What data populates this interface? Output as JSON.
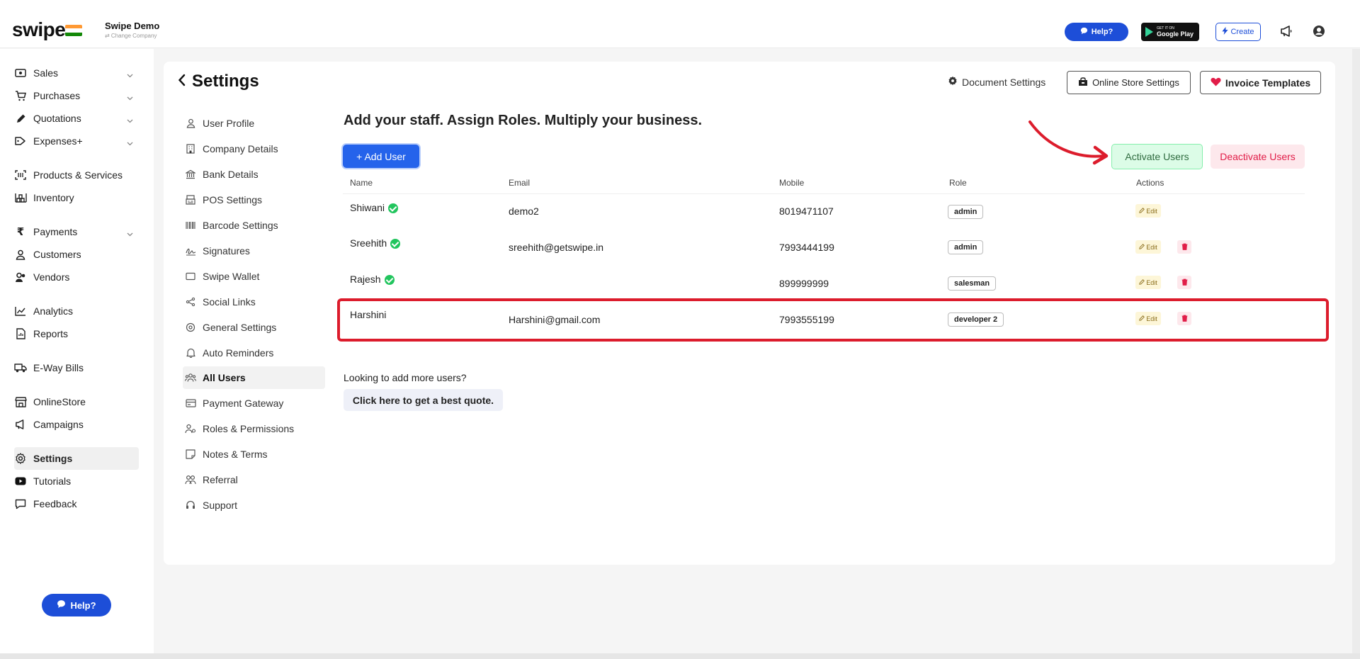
{
  "brand": {
    "logo": "swipe",
    "company_name": "Swipe Demo",
    "company_sub": "⇄ Change Company"
  },
  "topbar": {
    "help_label": "Help?",
    "gplay_top": "GET IT ON",
    "gplay_bottom": "Google Play",
    "create_label": "Create"
  },
  "sidebar": {
    "items": [
      {
        "label": "Sales"
      },
      {
        "label": "Purchases"
      },
      {
        "label": "Quotations"
      },
      {
        "label": "Expenses+"
      },
      {
        "label": "Products & Services"
      },
      {
        "label": "Inventory"
      },
      {
        "label": "Payments"
      },
      {
        "label": "Customers"
      },
      {
        "label": "Vendors"
      },
      {
        "label": "Analytics"
      },
      {
        "label": "Reports"
      },
      {
        "label": "E-Way Bills"
      },
      {
        "label": "OnlineStore"
      },
      {
        "label": "Campaigns"
      },
      {
        "label": "Settings"
      },
      {
        "label": "Tutorials"
      },
      {
        "label": "Feedback"
      }
    ],
    "help_label": "Help?"
  },
  "settings": {
    "title": "Settings",
    "document_settings": "Document Settings",
    "online_store_settings": "Online Store Settings",
    "invoice_templates": "Invoice Templates",
    "nav": [
      {
        "label": "User Profile"
      },
      {
        "label": "Company Details"
      },
      {
        "label": "Bank Details"
      },
      {
        "label": "POS Settings"
      },
      {
        "label": "Barcode Settings"
      },
      {
        "label": "Signatures"
      },
      {
        "label": "Swipe Wallet"
      },
      {
        "label": "Social Links"
      },
      {
        "label": "General Settings"
      },
      {
        "label": "Auto Reminders"
      },
      {
        "label": "All Users"
      },
      {
        "label": "Payment Gateway"
      },
      {
        "label": "Roles & Permissions"
      },
      {
        "label": "Notes & Terms"
      },
      {
        "label": "Referral"
      },
      {
        "label": "Support"
      }
    ]
  },
  "users": {
    "headline": "Add your staff. Assign Roles. Multiply your business.",
    "add_user_label": "+ Add User",
    "activate_label": "Activate Users",
    "deactivate_label": "Deactivate Users",
    "columns": {
      "name": "Name",
      "email": "Email",
      "mobile": "Mobile",
      "role": "Role",
      "actions": "Actions"
    },
    "edit_label": "Edit",
    "rows": [
      {
        "name": "Shiwani",
        "email": "demo2",
        "mobile": "8019471107",
        "role": "admin"
      },
      {
        "name": "Sreehith",
        "email": "sreehith@getswipe.in",
        "mobile": "7993444199",
        "role": "admin"
      },
      {
        "name": "Rajesh",
        "email": "",
        "mobile": "899999999",
        "role": "salesman"
      },
      {
        "name": "Harshini",
        "email": "Harshini@gmail.com",
        "mobile": "7993555199",
        "role": "developer 2"
      }
    ],
    "more_users_text": "Looking to add more users?",
    "quote_label": "Click here to get a best quote."
  },
  "colors": {
    "accent": "#1d4ed8",
    "active_green": "#22c55e",
    "danger": "#e11d48",
    "highlight": "#dc1c2c",
    "flag_saffron": "#ff9933",
    "flag_green": "#138808"
  }
}
